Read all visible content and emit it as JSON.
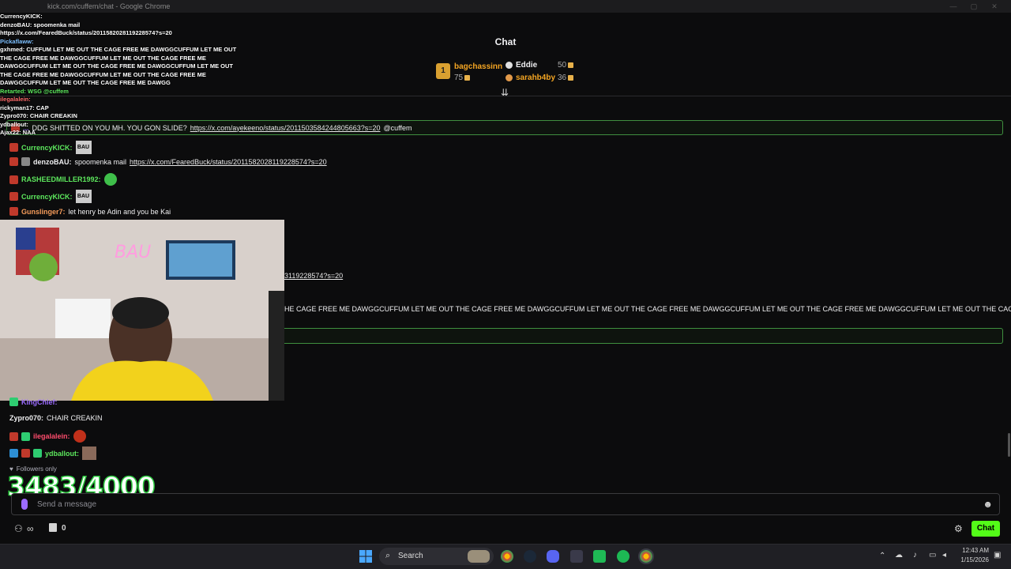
{
  "window": {
    "title": "kick.com/cuffem/chat - Google Chrome"
  },
  "chat": {
    "title": "Chat",
    "leaderboard": [
      {
        "rank": "1",
        "name": "bagchassinn",
        "count": "75"
      },
      {
        "rank": "",
        "name": "Eddie",
        "count": "50"
      },
      {
        "rank": "",
        "name": "sarahb4by",
        "count": "36"
      }
    ],
    "pinned_message": {
      "user": "...",
      "text": "DDG SHITTED ON YOU MH. YOU GON SLIDE?",
      "link": "https://x.com/ayekeeno/status/2011503584244805663?s=20",
      "mention": "@cuffem"
    },
    "messages": [
      {
        "user": "CurrencyKICK",
        "text": "",
        "color": "#5de85d"
      },
      {
        "user": "denzoBAU",
        "text": "spoomenka mail",
        "link": "https://x.com/FearedBuck/status/2011582028119228574?s=20",
        "color": "#efeff1"
      },
      {
        "user": "RASHEEDMILLER1992",
        "text": "",
        "color": "#5de85d"
      },
      {
        "user": "CurrencyKICK",
        "text": "",
        "color": "#5de85d"
      },
      {
        "user": "Gunslinger7",
        "text": "let henry be Adin and you be Kai",
        "color": "#f59b5a"
      }
    ],
    "partial_link": "3119228574?s=20",
    "partial_spam": "HE CAGE FREE ME DAWGGCUFFUM LET ME OUT THE CAGE FREE ME DAWGGCUFFUM LET ME OUT THE CAGE FREE ME DAWGGCUFFUM LET ME OUT THE CAGE FREE ME DAWGGCUFFUM LET ME OUT THE CAGE",
    "lower_messages": [
      {
        "user": "KingChief",
        "text": ""
      },
      {
        "user": "Zypro070",
        "text": "CHAIR CREAKIN"
      },
      {
        "user": "ilegalalein",
        "text": ""
      },
      {
        "user": "ydballout",
        "text": ""
      }
    ],
    "followers_only": "Followers only",
    "input_placeholder": "Send a message",
    "bottom_count": "0",
    "chat_button": "Chat"
  },
  "overlay": {
    "lines": [
      "CurrencyKICK:",
      "denzoBAU: spoomenka mail",
      "https://x.com/FearedBuck/status/2011582028119228574?s=20",
      "Pickaflaww:",
      "gxhmed: CUFFUM LET ME OUT THE CAGE FREE ME DAWGGCUFFUM LET ME OUT",
      "THE CAGE FREE ME DAWGGCUFFUM LET ME OUT THE CAGE FREE ME",
      "DAWGGCUFFUM LET ME OUT THE CAGE FREE ME DAWGGCUFFUM LET ME OUT",
      "THE CAGE FREE ME DAWGGCUFFUM LET ME OUT THE CAGE FREE ME",
      "DAWGGCUFFUM LET ME OUT THE CAGE FREE ME DAWGG",
      "Retarted: WSG @cuffem",
      "ilegalalein:",
      "rickyman17: CAP",
      "",
      "",
      "Zypro070: CHAIR CREAKIN",
      "ydballout:",
      "Ajax22: NAA"
    ],
    "counter": "3483/4000"
  },
  "taskbar": {
    "search_label": "Search",
    "time": "12:43 AM",
    "date": "1/15/2026"
  }
}
